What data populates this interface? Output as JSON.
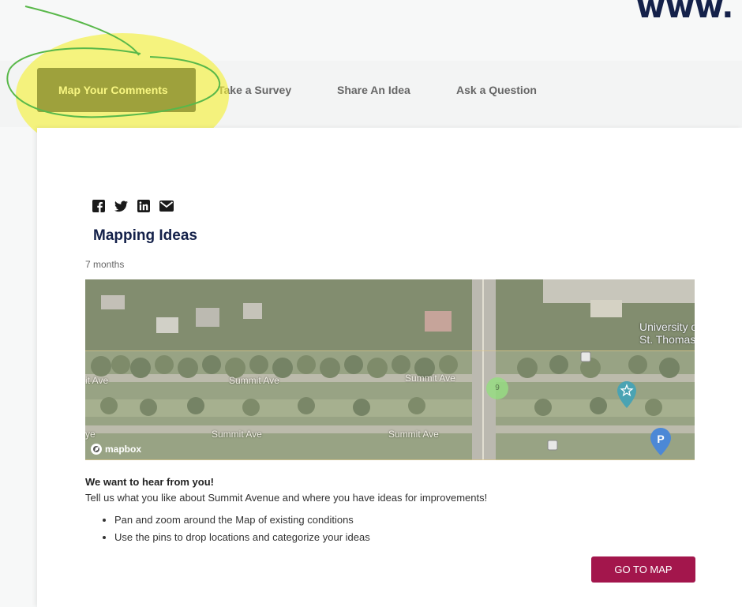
{
  "header": {
    "url_fragment": "www."
  },
  "tabs": [
    {
      "label": "Map Your Comments",
      "active": true
    },
    {
      "label": "Take a Survey"
    },
    {
      "label": "Share An Idea"
    },
    {
      "label": "Ask a Question"
    }
  ],
  "share": {
    "icons": [
      "facebook-icon",
      "twitter-icon",
      "linkedin-icon",
      "email-icon"
    ]
  },
  "post": {
    "title": "Mapping Ideas",
    "date": "7 months"
  },
  "map": {
    "labels": {
      "university_line1": "University of",
      "university_line2": "St. Thomas",
      "street_left": "it Ave",
      "street_upper_1": "Summit Ave",
      "street_upper_2": "Summit Ave",
      "street_lower_left": "ye",
      "street_lower_1": "Summit Ave",
      "street_lower_2": "Summit Ave"
    },
    "cluster_count": "9",
    "parking_label": "P",
    "attribution": "mapbox"
  },
  "content": {
    "heading": "We want to hear from you!",
    "text": "Tell us what you like about Summit Avenue and where you have ideas for improvements!",
    "bullets": [
      "Pan and zoom around the  Map of existing conditions",
      "Use the pins to drop locations and categorize your ideas"
    ]
  },
  "cta": {
    "label": "GO TO MAP"
  },
  "colors": {
    "navy": "#14214a",
    "cta": "#a3164c",
    "highlight": "#f3f033",
    "pen": "#59b84a"
  }
}
